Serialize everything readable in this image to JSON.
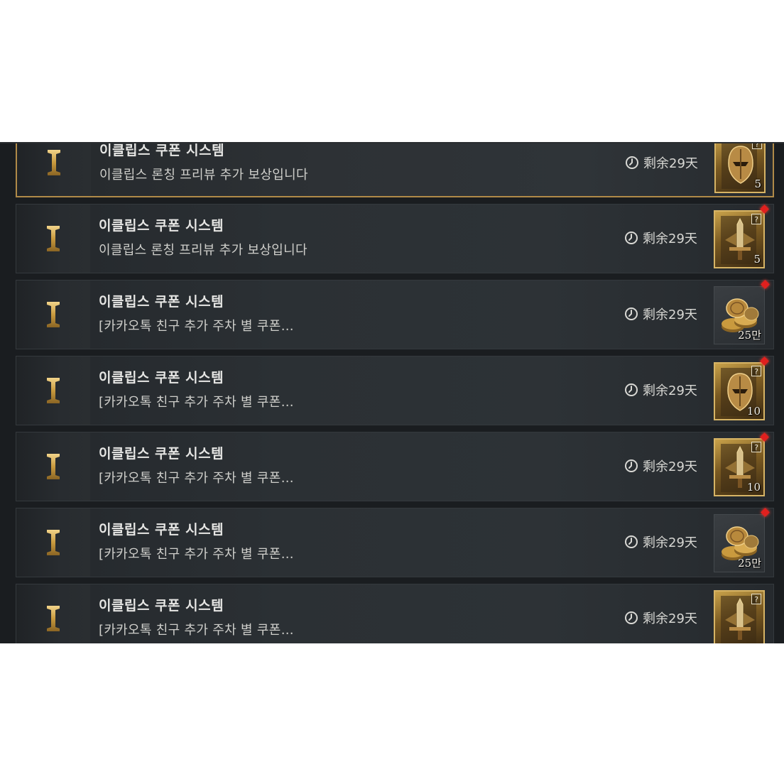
{
  "mails": [
    {
      "title": "이클립스 쿠폰 시스템",
      "desc": "이클립스 론칭 프리뷰 추가 보상입니다",
      "timer": "剩余29天",
      "reward": {
        "kind": "helmet-card",
        "count": "5",
        "has_question": true,
        "has_red_dot": false
      },
      "selected": true
    },
    {
      "title": "이클립스 쿠폰 시스템",
      "desc": "이클립스 론칭 프리뷰 추가 보상입니다",
      "timer": "剩余29天",
      "reward": {
        "kind": "sword-card",
        "count": "5",
        "has_question": true,
        "has_red_dot": true
      },
      "selected": false
    },
    {
      "title": "이클립스 쿠폰 시스템",
      "desc": "[카카오톡 친구 추가 주차 별 쿠폰…",
      "timer": "剩余29天",
      "reward": {
        "kind": "coins",
        "count": "25만",
        "has_question": false,
        "has_red_dot": true
      },
      "selected": false
    },
    {
      "title": "이클립스 쿠폰 시스템",
      "desc": "[카카오톡 친구 추가 주차 별 쿠폰…",
      "timer": "剩余29天",
      "reward": {
        "kind": "helmet-card",
        "count": "10",
        "has_question": true,
        "has_red_dot": true
      },
      "selected": false
    },
    {
      "title": "이클립스 쿠폰 시스템",
      "desc": "[카카오톡 친구 추가 주차 별 쿠폰…",
      "timer": "剩余29天",
      "reward": {
        "kind": "sword-card",
        "count": "10",
        "has_question": true,
        "has_red_dot": true
      },
      "selected": false
    },
    {
      "title": "이클립스 쿠폰 시스템",
      "desc": "[카카오톡 친구 추가 주차 별 쿠폰…",
      "timer": "剩余29天",
      "reward": {
        "kind": "coins",
        "count": "25만",
        "has_question": false,
        "has_red_dot": true
      },
      "selected": false
    },
    {
      "title": "이클립스 쿠폰 시스템",
      "desc": "[카카오톡 친구 추가 주차 별 쿠폰…",
      "timer": "剩余29天",
      "reward": {
        "kind": "sword-card",
        "count": "",
        "has_question": true,
        "has_red_dot": false
      },
      "selected": false
    }
  ],
  "icons": {
    "mail_icon": "roman-numeral-one-icon",
    "timer_icon": "clock-icon"
  },
  "colors": {
    "accent_gold": "#b08a48",
    "icon_gold": "#d9b463",
    "red_dot": "#e0201e"
  }
}
